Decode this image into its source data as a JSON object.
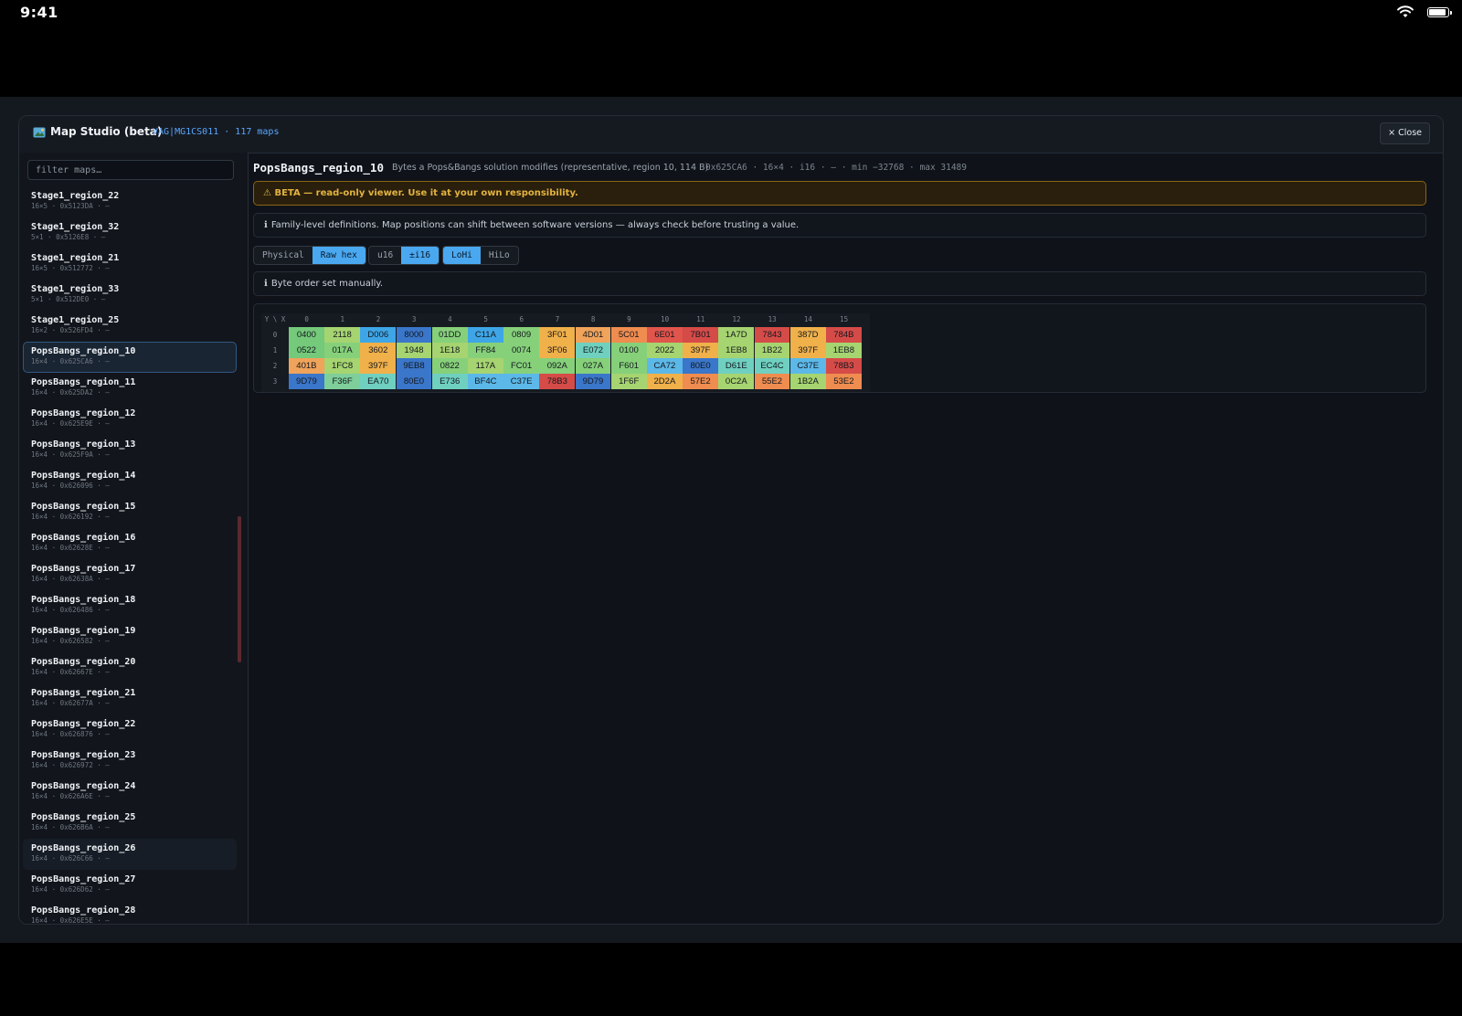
{
  "status_bar": {
    "time": "9:41"
  },
  "modal": {
    "title": "Map Studio (beta)",
    "subtitle": "VAG|MG1CS011 · 117 maps",
    "close_label": "× Close"
  },
  "sidebar": {
    "filter_placeholder": "filter maps…",
    "items": [
      {
        "name": "Stage1_region_22",
        "meta": "16×5 · 0x5123DA · —"
      },
      {
        "name": "Stage1_region_32",
        "meta": "5×1 · 0x5126E8 · —"
      },
      {
        "name": "Stage1_region_21",
        "meta": "16×5 · 0x512772 · —"
      },
      {
        "name": "Stage1_region_33",
        "meta": "5×1 · 0x512DE0 · —"
      },
      {
        "name": "Stage1_region_25",
        "meta": "16×2 · 0x526FD4 · —"
      },
      {
        "name": "PopsBangs_region_10",
        "meta": "16×4 · 0x625CA6 · —",
        "selected": true
      },
      {
        "name": "PopsBangs_region_11",
        "meta": "16×4 · 0x625DA2 · —"
      },
      {
        "name": "PopsBangs_region_12",
        "meta": "16×4 · 0x625E9E · —"
      },
      {
        "name": "PopsBangs_region_13",
        "meta": "16×4 · 0x625F9A · —"
      },
      {
        "name": "PopsBangs_region_14",
        "meta": "16×4 · 0x626096 · —"
      },
      {
        "name": "PopsBangs_region_15",
        "meta": "16×4 · 0x626192 · —"
      },
      {
        "name": "PopsBangs_region_16",
        "meta": "16×4 · 0x62628E · —"
      },
      {
        "name": "PopsBangs_region_17",
        "meta": "16×4 · 0x62638A · —"
      },
      {
        "name": "PopsBangs_region_18",
        "meta": "16×4 · 0x626486 · —"
      },
      {
        "name": "PopsBangs_region_19",
        "meta": "16×4 · 0x626582 · —"
      },
      {
        "name": "PopsBangs_region_20",
        "meta": "16×4 · 0x62667E · —"
      },
      {
        "name": "PopsBangs_region_21",
        "meta": "16×4 · 0x62677A · —"
      },
      {
        "name": "PopsBangs_region_22",
        "meta": "16×4 · 0x626876 · —"
      },
      {
        "name": "PopsBangs_region_23",
        "meta": "16×4 · 0x626972 · —"
      },
      {
        "name": "PopsBangs_region_24",
        "meta": "16×4 · 0x626A6E · —"
      },
      {
        "name": "PopsBangs_region_25",
        "meta": "16×4 · 0x626B6A · —"
      },
      {
        "name": "PopsBangs_region_26",
        "meta": "16×4 · 0x626C66 · —",
        "hovered": true
      },
      {
        "name": "PopsBangs_region_27",
        "meta": "16×4 · 0x626D62 · —"
      },
      {
        "name": "PopsBangs_region_28",
        "meta": "16×4 · 0x626E5E · —"
      }
    ]
  },
  "detail": {
    "name": "PopsBangs_region_10",
    "description": "Bytes a Pops&Bangs solution modifies (representative, region 10, 114 B)",
    "meta": "0x625CA6 · 16×4 · i16 · — · min −32768 · max 31489",
    "beta_warning": "⚠ BETA — read-only viewer. Use it at your own responsibility.",
    "family_note": "Family-level definitions. Map positions can shift between software versions — always check before trusting a value.",
    "byte_order_note": "Byte order set manually.",
    "note_icon": "ℹ",
    "mode_options": [
      {
        "label": "Physical",
        "active": false
      },
      {
        "label": "Raw hex",
        "active": true
      }
    ],
    "type_options": [
      {
        "label": "u16",
        "active": false
      },
      {
        "label": "±i16",
        "active": true
      }
    ],
    "order_options": [
      {
        "label": "LoHi",
        "active": true
      },
      {
        "label": "HiLo",
        "active": false
      }
    ]
  },
  "grid": {
    "corner_label": "Y \\ X",
    "x_headers": [
      "0",
      "1",
      "2",
      "3",
      "4",
      "5",
      "6",
      "7",
      "8",
      "9",
      "10",
      "11",
      "12",
      "13",
      "14",
      "15"
    ],
    "y_headers": [
      "0",
      "1",
      "2",
      "3"
    ],
    "rows": [
      [
        "0400",
        "2118",
        "D006",
        "8000",
        "01DD",
        "C11A",
        "0809",
        "3F01",
        "4D01",
        "5C01",
        "6E01",
        "7B01",
        "1A7D",
        "7843",
        "387D",
        "784B"
      ],
      [
        "0522",
        "017A",
        "3602",
        "1948",
        "1E18",
        "FF84",
        "0074",
        "3F06",
        "E072",
        "0100",
        "2022",
        "397F",
        "1EB8",
        "1B22",
        "397F",
        "1EB8"
      ],
      [
        "401B",
        "1FC8",
        "397F",
        "9EB8",
        "0822",
        "117A",
        "FC01",
        "092A",
        "027A",
        "F601",
        "CA72",
        "80E0",
        "D61E",
        "EC4C",
        "C37E",
        "78B3"
      ],
      [
        "9D79",
        "F36F",
        "EA70",
        "80E0",
        "E736",
        "BF4C",
        "C37E",
        "78B3",
        "9D79",
        "1F6F",
        "2D2A",
        "57E2",
        "0C2A",
        "55E2",
        "1B2A",
        "53E2"
      ]
    ],
    "colors": [
      [
        "#74c97a",
        "#a6d470",
        "#3ea6e6",
        "#3a76c9",
        "#86d07a",
        "#3ea6e6",
        "#86d07a",
        "#f0b04a",
        "#f0a35a",
        "#ef8c4f",
        "#e0554c",
        "#d54b48",
        "#a6d470",
        "#d54b48",
        "#f0b04a",
        "#d54b48"
      ],
      [
        "#74c97a",
        "#86d07a",
        "#f0b04a",
        "#a6d470",
        "#a6d470",
        "#86d07a",
        "#86d07a",
        "#f0b04a",
        "#6fd0c0",
        "#86d07a",
        "#a6d470",
        "#f0b04a",
        "#a6d470",
        "#a6d470",
        "#f0b04a",
        "#a6d470"
      ],
      [
        "#f0a35a",
        "#a6d470",
        "#f0b04a",
        "#3a76c9",
        "#86d07a",
        "#a6d470",
        "#86d07a",
        "#86d07a",
        "#86d07a",
        "#86d07a",
        "#5cb8e8",
        "#3a76c9",
        "#6fd0c0",
        "#6fd0c0",
        "#5cb8e8",
        "#d54b48"
      ],
      [
        "#3a76c9",
        "#7ecf9a",
        "#6fd0c0",
        "#3a76c9",
        "#6fd0c0",
        "#5cb8e8",
        "#5cb8e8",
        "#d54b48",
        "#3a76c9",
        "#a6d470",
        "#f0b04a",
        "#ef8c4f",
        "#a6d470",
        "#ef8c4f",
        "#a6d470",
        "#ef8c4f"
      ]
    ]
  },
  "icons": {
    "title": "map-icon",
    "wifi": "wifi-icon",
    "battery": "battery-icon"
  }
}
